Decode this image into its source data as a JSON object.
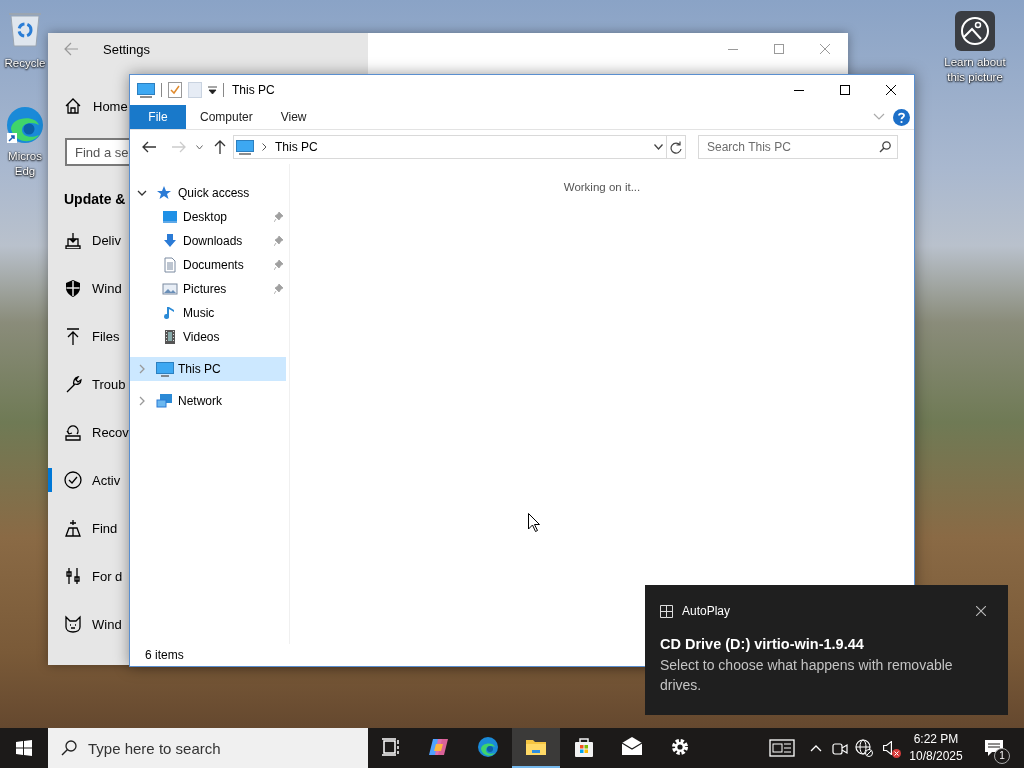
{
  "desktop": {
    "icons": [
      {
        "kind": "recycle",
        "label": "Recycle"
      },
      {
        "kind": "edge",
        "label": "Micros Edg"
      },
      {
        "kind": "learn",
        "label": "Learn about this picture"
      }
    ]
  },
  "settings": {
    "title": "Settings",
    "active": false,
    "home": "Home",
    "search": {
      "placeholder": "Find a se"
    },
    "section": "Update &",
    "nav": [
      {
        "kind": "delivery",
        "label": "Deliv",
        "selected": false
      },
      {
        "kind": "shield",
        "label": "Wind",
        "selected": false
      },
      {
        "kind": "upload",
        "label": "Files",
        "selected": false
      },
      {
        "kind": "wrench",
        "label": "Troub",
        "selected": false
      },
      {
        "kind": "recovery",
        "label": "Recov",
        "selected": false
      },
      {
        "kind": "activation",
        "label": "Activ",
        "selected": true
      },
      {
        "kind": "find",
        "label": "Find",
        "selected": false
      },
      {
        "kind": "developer",
        "label": "For d",
        "selected": false
      },
      {
        "kind": "insider",
        "label": "Wind",
        "selected": false
      }
    ]
  },
  "explorer": {
    "title": "This PC",
    "active": true,
    "tabs": [
      {
        "kind": "file",
        "label": "File",
        "selected": false
      },
      {
        "kind": "tab",
        "label": "Computer",
        "selected": false
      },
      {
        "kind": "tab",
        "label": "View",
        "selected": false
      }
    ],
    "address": {
      "location": "This PC"
    },
    "search": {
      "placeholder": "Search This PC"
    },
    "tree": [
      {
        "kind": "star",
        "label": "Quick access",
        "expanded": true,
        "selected": false,
        "children": [
          {
            "kind": "desktop",
            "label": "Desktop",
            "pinned": true,
            "selected": false
          },
          {
            "kind": "download",
            "label": "Downloads",
            "pinned": true,
            "selected": false
          },
          {
            "kind": "documents",
            "label": "Documents",
            "pinned": true,
            "selected": false
          },
          {
            "kind": "pictures",
            "label": "Pictures",
            "pinned": true,
            "selected": false
          },
          {
            "kind": "music",
            "label": "Music",
            "pinned": false,
            "selected": false
          },
          {
            "kind": "videos",
            "label": "Videos",
            "pinned": false,
            "selected": false
          }
        ]
      },
      {
        "kind": "pc",
        "label": "This PC",
        "expanded": false,
        "selected": true
      },
      {
        "kind": "network",
        "label": "Network",
        "expanded": false,
        "selected": false
      }
    ],
    "message": "Working on it...",
    "status": "6 items"
  },
  "toast": {
    "app": "AutoPlay",
    "title": "CD Drive (D:) virtio-win-1.9.44",
    "body": "Select to choose what happens with removable drives."
  },
  "taskbar": {
    "search": {
      "placeholder": "Type here to search"
    },
    "apps": [
      {
        "kind": "taskview",
        "active": false
      },
      {
        "kind": "copilot",
        "active": false
      },
      {
        "kind": "edge",
        "active": false
      },
      {
        "kind": "explorer",
        "active": true
      },
      {
        "kind": "store",
        "active": false
      },
      {
        "kind": "mail",
        "active": false
      },
      {
        "kind": "settings",
        "active": false
      }
    ],
    "tray": [
      {
        "kind": "news"
      },
      {
        "kind": "chevron"
      },
      {
        "kind": "meet"
      },
      {
        "kind": "network"
      },
      {
        "kind": "volume",
        "muted": true
      }
    ],
    "time": "6:22 PM",
    "date": "10/8/2025",
    "notification_count": "1"
  }
}
